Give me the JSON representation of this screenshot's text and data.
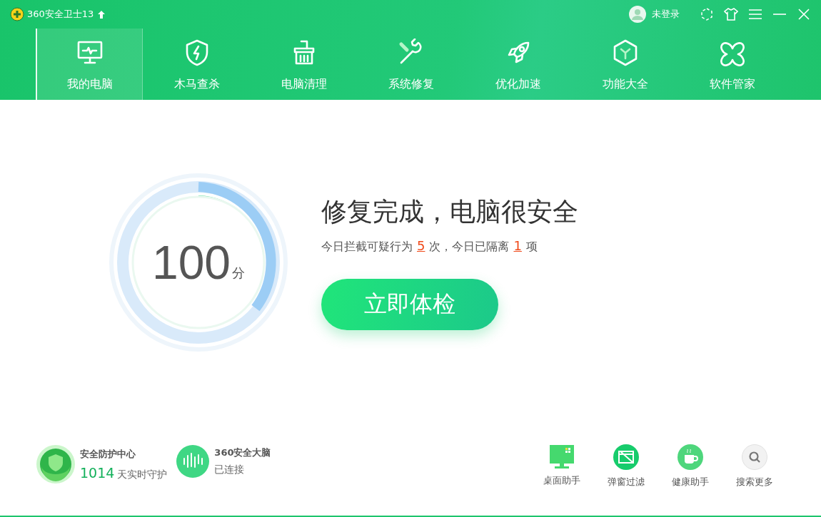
{
  "window": {
    "title": "360安全卫士13"
  },
  "account": {
    "label": "未登录"
  },
  "tabs": [
    {
      "label": "我的电脑",
      "selected": true
    },
    {
      "label": "木马查杀",
      "selected": false
    },
    {
      "label": "电脑清理",
      "selected": false
    },
    {
      "label": "系统修复",
      "selected": false
    },
    {
      "label": "优化加速",
      "selected": false
    },
    {
      "label": "功能大全",
      "selected": false
    },
    {
      "label": "软件管家",
      "selected": false
    }
  ],
  "score": {
    "value": "100",
    "unit": "分"
  },
  "headline": "修复完成，电脑很安全",
  "stats": {
    "prefix": "今日拦截可疑行为",
    "blocked": "5",
    "middle": "次，今日已隔离",
    "quarantined": "1",
    "suffix": "项"
  },
  "check_button": "立即体检",
  "services": [
    {
      "title": "安全防护中心",
      "count": "1014",
      "status": "天实时守护"
    },
    {
      "title": "360安全大脑",
      "status": "已连接"
    }
  ],
  "tools": [
    {
      "label": "桌面助手"
    },
    {
      "label": "弹窗过滤"
    },
    {
      "label": "健康助手"
    },
    {
      "label": "搜索更多"
    }
  ]
}
